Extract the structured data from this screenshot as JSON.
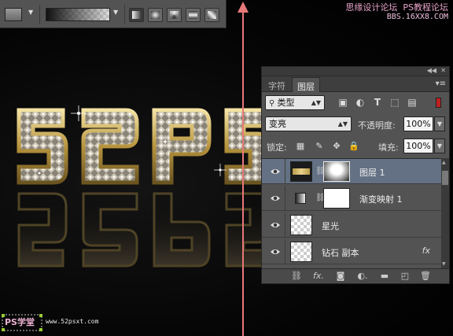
{
  "watermark": {
    "line1": "思缘设计论坛",
    "line1b": "PS教程论坛",
    "line2": "BBS.16XX8.COM"
  },
  "logo": {
    "tag": "PS学堂",
    "url": "www.52psxt.com"
  },
  "artwork": {
    "text": "52PS"
  },
  "options_bar": {
    "icons": [
      "tool-preset-icon",
      "gradient-swatch-icon",
      "linear-gradient-icon",
      "radial-gradient-icon",
      "angle-gradient-icon",
      "reflected-gradient-icon",
      "diamond-gradient-icon"
    ]
  },
  "panel": {
    "tabs": [
      {
        "label": "字符"
      },
      {
        "label": "图层"
      }
    ],
    "active_tab": "图层",
    "filter": {
      "kind_label": "类型"
    },
    "blend_mode": "变亮",
    "opacity_label": "不透明度:",
    "opacity_value": "100%",
    "lock_label": "锁定:",
    "fill_label": "填充:",
    "fill_value": "100%",
    "layers": [
      {
        "name": "图层 1",
        "selected": true,
        "has_mask": true
      },
      {
        "name": "渐变映射 1",
        "selected": false,
        "adjustment": true
      },
      {
        "name": "星光",
        "selected": false
      },
      {
        "name": "钻石 副本",
        "selected": false,
        "fx": "fx"
      }
    ]
  },
  "colors": {
    "accent_selected_row": "#647184",
    "arrow": "#e8787a",
    "panel_bg": "#535353"
  }
}
